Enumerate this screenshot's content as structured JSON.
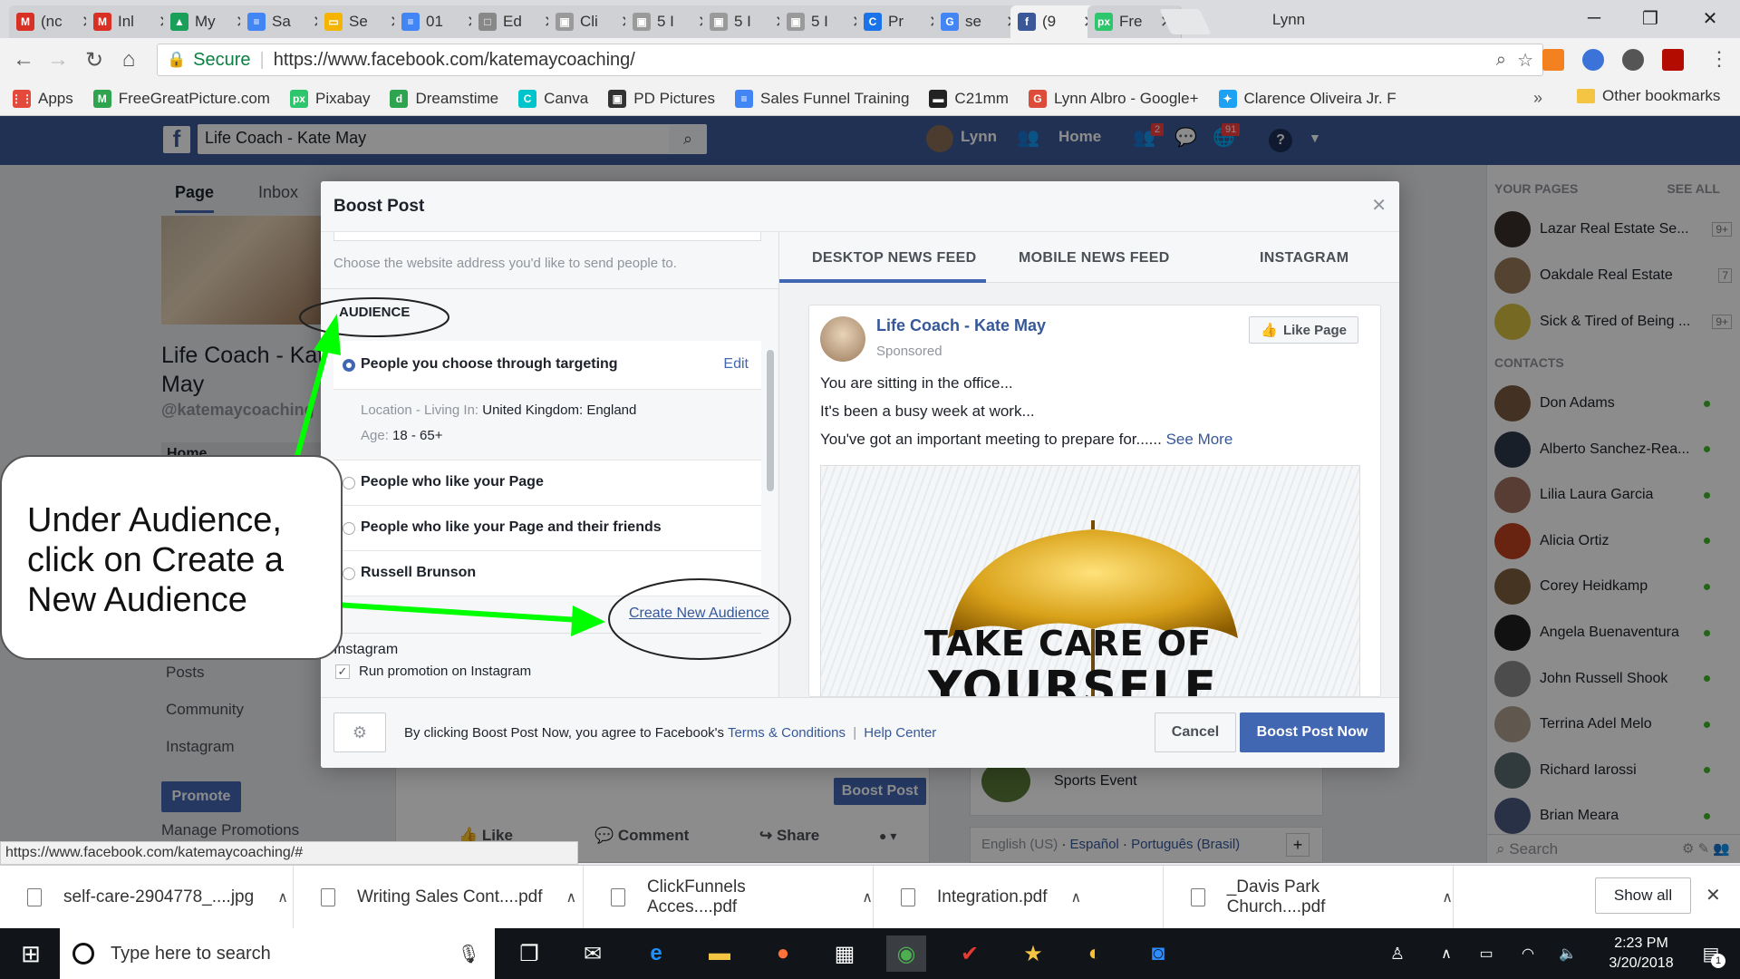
{
  "browser": {
    "profile": "Lynn",
    "tabs": [
      {
        "label": "(nc",
        "icon": "gmail-icon",
        "color": "#d93025",
        "glyph": "M"
      },
      {
        "label": "Inl",
        "icon": "gmail-icon",
        "color": "#d93025",
        "glyph": "M"
      },
      {
        "label": "My",
        "icon": "drive-icon",
        "color": "#1a9f5b",
        "glyph": "▲"
      },
      {
        "label": "Sa",
        "icon": "docs-icon",
        "color": "#4285f4",
        "glyph": "≡"
      },
      {
        "label": "Se",
        "icon": "slides-icon",
        "color": "#f4b400",
        "glyph": "▭"
      },
      {
        "label": "01",
        "icon": "docs-icon",
        "color": "#4285f4",
        "glyph": "≡"
      },
      {
        "label": "Ed",
        "icon": "page-icon",
        "color": "#888888",
        "glyph": "□"
      },
      {
        "label": "Cli",
        "icon": "image-icon",
        "color": "#9a9a9a",
        "glyph": "▣"
      },
      {
        "label": "5 I",
        "icon": "image-icon",
        "color": "#9a9a9a",
        "glyph": "▣"
      },
      {
        "label": "5 I",
        "icon": "image-icon",
        "color": "#9a9a9a",
        "glyph": "▣"
      },
      {
        "label": "5 I",
        "icon": "image-icon",
        "color": "#9a9a9a",
        "glyph": "▣"
      },
      {
        "label": "Pr",
        "icon": "c-icon",
        "color": "#1a73e8",
        "glyph": "C"
      },
      {
        "label": "se",
        "icon": "google-icon",
        "color": "#4285f4",
        "glyph": "G"
      },
      {
        "label": "(9",
        "icon": "facebook-icon",
        "color": "#3b5998",
        "glyph": "f"
      },
      {
        "label": "Fre",
        "icon": "pixabay-icon",
        "color": "#2ec66d",
        "glyph": "px"
      }
    ],
    "secure_label": "Secure",
    "url": "https://www.facebook.com/katemaycoaching/",
    "bookmarks": [
      {
        "label": "Apps",
        "color": "#e34a3c",
        "glyph": "⋮⋮"
      },
      {
        "label": "FreeGreatPicture.com",
        "color": "#2ea44f",
        "glyph": "M"
      },
      {
        "label": "Pixabay",
        "color": "#2ec66d",
        "glyph": "px"
      },
      {
        "label": "Dreamstime",
        "color": "#2ea44f",
        "glyph": "d"
      },
      {
        "label": "Canva",
        "color": "#00c4cc",
        "glyph": "C"
      },
      {
        "label": "PD Pictures",
        "color": "#333333",
        "glyph": "▣"
      },
      {
        "label": "Sales Funnel Training",
        "color": "#4285f4",
        "glyph": "≡"
      },
      {
        "label": "C21mm",
        "color": "#222222",
        "glyph": "▬"
      },
      {
        "label": "Lynn Albro - Google+",
        "color": "#dd4b39",
        "glyph": "G"
      },
      {
        "label": "Clarence Oliveira Jr. F",
        "color": "#1da1f2",
        "glyph": "✦"
      }
    ],
    "other_bookmarks": "Other bookmarks"
  },
  "facebook": {
    "search_value": "Life Coach  - Kate May",
    "user_name": "Lynn",
    "home_label": "Home",
    "friend_badge": "2",
    "notif_badge": "91",
    "page_tabs": [
      "Page",
      "Inbox"
    ],
    "page_name": "Life Coach - Kate May",
    "page_handle": "@katemaycoaching",
    "left_nav": [
      "Home",
      "Posts",
      "Community",
      "Instagram"
    ],
    "promote_label": "Promote",
    "manage_promotions": "Manage Promotions",
    "boost_post_label": "Boost Post",
    "like_label": "Like",
    "comment_label": "Comment",
    "share_label": "Share",
    "sports_event": "Sports Event",
    "languages": {
      "current": "English (US)",
      "others": [
        "Español",
        "Português (Brasil)"
      ]
    },
    "right": {
      "your_pages": "YOUR PAGES",
      "see_all": "SEE ALL",
      "pages": [
        {
          "name": "Lazar Real Estate Se...",
          "count": "9+"
        },
        {
          "name": "Oakdale Real Estate",
          "count": "7"
        },
        {
          "name": "Sick & Tired of Being ...",
          "count": "9+"
        }
      ],
      "contacts_title": "CONTACTS",
      "contacts": [
        "Don Adams",
        "Alberto Sanchez-Rea...",
        "Lilia Laura Garcia",
        "Alicia Ortiz",
        "Corey Heidkamp",
        "Angela Buenaventura",
        "John Russell Shook",
        "Terrina Adel Melo",
        "Richard Iarossi",
        "Brian Meara"
      ],
      "search_placeholder": "Search"
    }
  },
  "modal": {
    "title": "Boost Post",
    "website_hint": "Choose the website address you'd like to send people to.",
    "audience_title": "AUDIENCE",
    "audience_options": [
      "People you choose through targeting",
      "People who like your Page",
      "People who like your Page and their friends",
      "Russell Brunson"
    ],
    "edit_label": "Edit",
    "location_label": "Location - Living In:",
    "location_value": "United Kingdom: England",
    "age_label": "Age:",
    "age_value": "18 - 65+",
    "create_audience": "Create New Audience",
    "instagram_heading": "Instagram",
    "instagram_option": "Run promotion on Instagram",
    "instagram_checked": true,
    "preview_tabs": [
      "DESKTOP NEWS FEED",
      "MOBILE NEWS FEED",
      "INSTAGRAM"
    ],
    "post": {
      "page_name": "Life Coach - Kate May",
      "sponsored": "Sponsored",
      "like_page": "Like Page",
      "lines": [
        "You are sitting in the office...",
        "It's been a busy week at work...",
        "You've got an important meeting to prepare for......"
      ],
      "see_more": "See More",
      "image_text_1": "TAKE CARE OF",
      "image_text_2": "YOURSELF"
    },
    "footer": {
      "agree_text": "By clicking Boost Post Now, you agree to Facebook's",
      "terms": "Terms & Conditions",
      "separator": "|",
      "help": "Help Center",
      "cancel": "Cancel",
      "boost_now": "Boost Post Now"
    }
  },
  "annotation": {
    "callout_text": "Under Audience, click on Create a New Audience",
    "arrow_color": "#00ff00"
  },
  "status_url": "https://www.facebook.com/katemaycoaching/#",
  "downloads": {
    "items": [
      "self-care-2904778_....jpg",
      "Writing Sales Cont....pdf",
      "ClickFunnels Acces....pdf",
      "Integration.pdf",
      "_Davis Park Church....pdf"
    ],
    "show_all": "Show all"
  },
  "taskbar": {
    "search_placeholder": "Type here to search",
    "time": "2:23 PM",
    "date": "3/20/2018",
    "notification_count": "1"
  }
}
